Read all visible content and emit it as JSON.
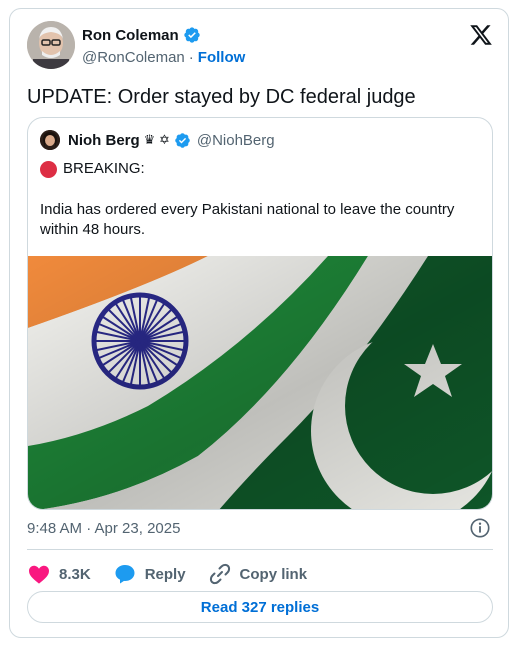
{
  "author": {
    "name": "Ron Coleman",
    "handle": "@RonColeman",
    "separator": "·",
    "follow_label": "Follow"
  },
  "tweet": {
    "text": "UPDATE: Order stayed by DC federal judge",
    "timestamp": "9:48 AM · Apr 23, 2025"
  },
  "quoted": {
    "name": "Nioh Berg",
    "name_emojis": "♛ ✡",
    "handle": "@NiohBerg",
    "line1": "BREAKING:",
    "body": "India has ordered every Pakistani national to leave the country within 48 hours."
  },
  "actions": {
    "like_count": "8.3K",
    "reply_label": "Reply",
    "copy_label": "Copy link"
  },
  "replies_button": "Read 327 replies",
  "colors": {
    "accent": "#006fd6",
    "like": "#f91880",
    "reply": "#1d9bf0",
    "verified": "#1d9bf0",
    "india_saffron": "#f08a3c",
    "india_green": "#1f8a3a",
    "pakistan_green": "#0f5a2a",
    "chakra": "#2a2a8c"
  },
  "icons": {
    "verified": "verified-badge-icon",
    "x_logo": "x-logo-icon",
    "info": "info-icon",
    "like": "heart-icon",
    "reply": "speech-bubble-icon",
    "copy": "link-icon"
  }
}
